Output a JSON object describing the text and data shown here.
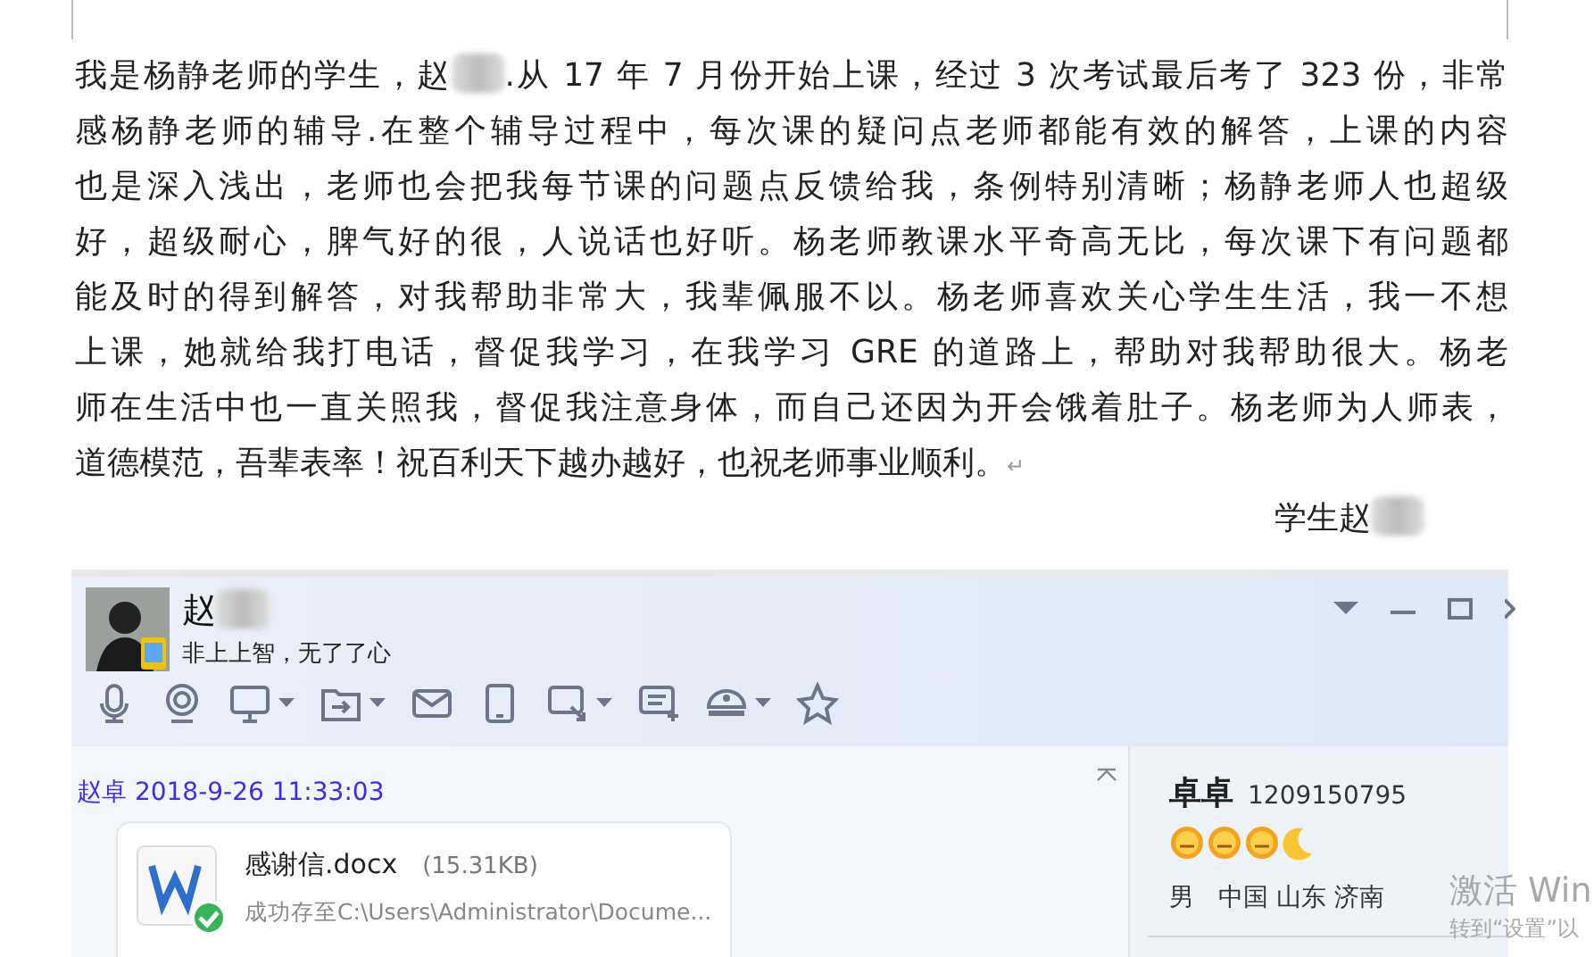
{
  "letter": {
    "lines": [
      [
        {
          "kind": "text",
          "text": "我是杨静老师的学生，赵"
        },
        {
          "kind": "redacted"
        },
        {
          "kind": "text",
          "text": ".从 17 年 7 月份开始上课，经过 3 次考试最后考了 323 份，非常"
        }
      ],
      [
        {
          "kind": "text",
          "text": "感杨静老师的辅导.在整个辅导过程中，每次课的疑问点老师都能有效的解答，上课的内容"
        }
      ],
      [
        {
          "kind": "text",
          "text": "也是深入浅出，老师也会把我每节课的问题点反馈给我，条例特别清晰；杨静老师人也超级"
        }
      ],
      [
        {
          "kind": "text",
          "text": "好，超级耐心，脾气好的很，人说话也好听。杨老师教课水平奇高无比，每次课下有问题都"
        }
      ],
      [
        {
          "kind": "text",
          "text": "能及时的得到解答，对我帮助非常大，我辈佩服不以。杨老师喜欢关心学生生活，我一不想"
        }
      ],
      [
        {
          "kind": "text",
          "text": "上课，她就给我打电话，督促我学习，在我学习 GRE 的道路上，帮助对我帮助很大。杨老"
        }
      ],
      [
        {
          "kind": "text",
          "text": "师在生活中也一直关照我，督促我注意身体，而自己还因为开会饿着肚子。杨老师为人师表，"
        }
      ],
      [
        {
          "kind": "text",
          "text": "道德模范，吾辈表率！祝百利天下越办越好，也祝老师事业顺利。"
        },
        {
          "kind": "mark",
          "text": "↵"
        }
      ]
    ],
    "signature": [
      {
        "kind": "text",
        "text": "学生赵"
      },
      {
        "kind": "redacted"
      }
    ]
  },
  "chat": {
    "contact_name": [
      {
        "kind": "text",
        "text": "赵"
      },
      {
        "kind": "redacted"
      }
    ],
    "signature": "非上上智，无了了心",
    "toolbar": [
      {
        "kind": "mic",
        "dropdown": false
      },
      {
        "kind": "camera",
        "dropdown": false
      },
      {
        "kind": "screen",
        "dropdown": true
      },
      {
        "kind": "folder",
        "dropdown": true
      },
      {
        "kind": "mail",
        "dropdown": false
      },
      {
        "kind": "phone",
        "dropdown": false
      },
      {
        "kind": "capture",
        "dropdown": true
      },
      {
        "kind": "note",
        "dropdown": false
      },
      {
        "kind": "hat",
        "dropdown": true
      },
      {
        "kind": "star",
        "dropdown": false
      }
    ],
    "message": {
      "sender": "赵卓 2018-9-26 11:33:03",
      "file_name": "感谢信.docx",
      "file_size": "(15.31KB)",
      "status": "成功存至C:\\Users\\Administrator\\Docume..."
    },
    "profile": {
      "nickname": "卓卓",
      "number": "1209150795",
      "info": "男   中国 山东 济南"
    }
  },
  "os_notice": {
    "title": "激活 Win",
    "subtitle": "转到“设置”以"
  }
}
